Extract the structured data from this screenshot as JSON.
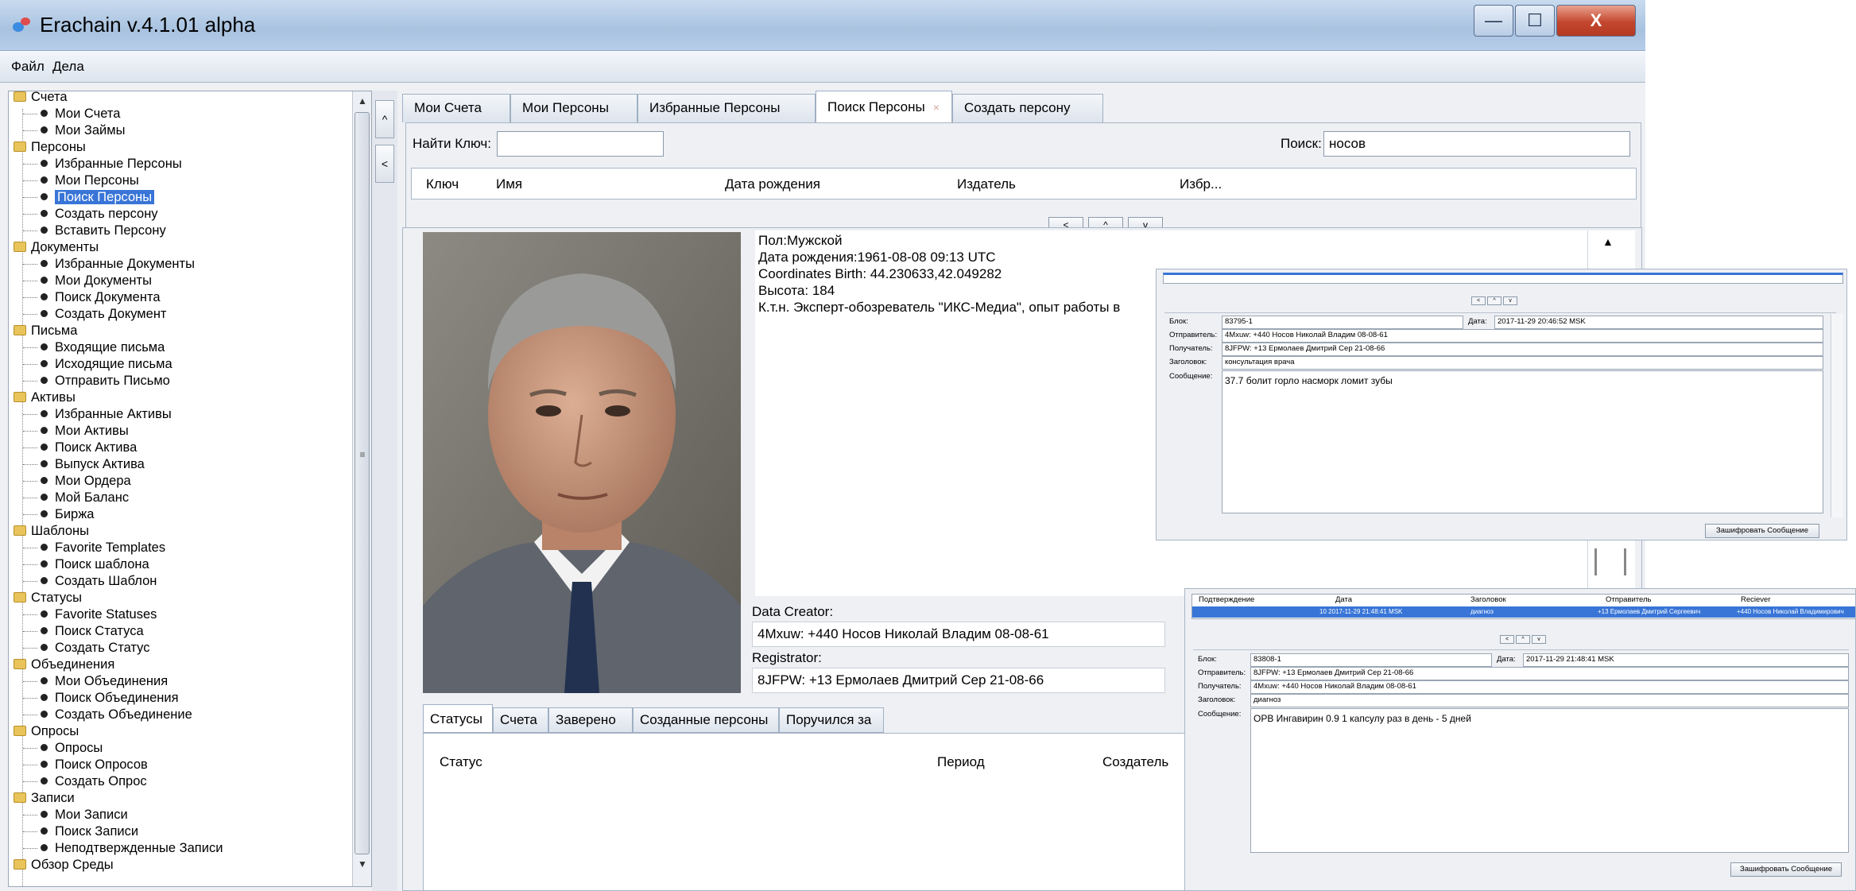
{
  "window": {
    "title": "Erachain v.4.1.01 alpha",
    "min": "—",
    "max": "☐",
    "close": "X"
  },
  "menu": [
    "Файл",
    "Дела"
  ],
  "tree": [
    {
      "label": "Счета",
      "type": "folder"
    },
    {
      "label": "Мои Счета",
      "type": "leaf"
    },
    {
      "label": "Мои Займы",
      "type": "leaf"
    },
    {
      "label": "Персоны",
      "type": "folder"
    },
    {
      "label": "Избранные Персоны",
      "type": "leaf"
    },
    {
      "label": "Мои Персоны",
      "type": "leaf"
    },
    {
      "label": "Поиск Персоны",
      "type": "leaf",
      "selected": true
    },
    {
      "label": "Создать персону",
      "type": "leaf"
    },
    {
      "label": "Вставить Персону",
      "type": "leaf"
    },
    {
      "label": "Документы",
      "type": "folder"
    },
    {
      "label": "Избранные Документы",
      "type": "leaf"
    },
    {
      "label": "Мои Документы",
      "type": "leaf"
    },
    {
      "label": "Поиск Документа",
      "type": "leaf"
    },
    {
      "label": "Создать Документ",
      "type": "leaf"
    },
    {
      "label": "Письма",
      "type": "folder"
    },
    {
      "label": "Входящие письма",
      "type": "leaf"
    },
    {
      "label": "Исходящие письма",
      "type": "leaf"
    },
    {
      "label": "Отправить Письмо",
      "type": "leaf"
    },
    {
      "label": "Активы",
      "type": "folder"
    },
    {
      "label": "Избранные Активы",
      "type": "leaf"
    },
    {
      "label": "Мои Активы",
      "type": "leaf"
    },
    {
      "label": "Поиск Актива",
      "type": "leaf"
    },
    {
      "label": "Выпуск Актива",
      "type": "leaf"
    },
    {
      "label": "Мои Ордера",
      "type": "leaf"
    },
    {
      "label": "Мой Баланс",
      "type": "leaf"
    },
    {
      "label": "Биржа",
      "type": "leaf"
    },
    {
      "label": "Шаблоны",
      "type": "folder"
    },
    {
      "label": "Favorite Templates",
      "type": "leaf"
    },
    {
      "label": "Поиск шаблона",
      "type": "leaf"
    },
    {
      "label": "Создать Шаблон",
      "type": "leaf"
    },
    {
      "label": "Статусы",
      "type": "folder"
    },
    {
      "label": "Favorite Statuses",
      "type": "leaf"
    },
    {
      "label": "Поиск Статуса",
      "type": "leaf"
    },
    {
      "label": "Создать Статус",
      "type": "leaf"
    },
    {
      "label": "Объединения",
      "type": "folder"
    },
    {
      "label": "Мои Объединения",
      "type": "leaf"
    },
    {
      "label": "Поиск Объединения",
      "type": "leaf"
    },
    {
      "label": "Создать Объединение",
      "type": "leaf"
    },
    {
      "label": "Опросы",
      "type": "folder"
    },
    {
      "label": "Опросы",
      "type": "leaf"
    },
    {
      "label": "Поиск Опросов",
      "type": "leaf"
    },
    {
      "label": "Создать Опрос",
      "type": "leaf"
    },
    {
      "label": "Записи",
      "type": "folder"
    },
    {
      "label": "Мои Записи",
      "type": "leaf"
    },
    {
      "label": "Поиск Записи",
      "type": "leaf"
    },
    {
      "label": "Неподтвержденные Записи",
      "type": "leaf"
    },
    {
      "label": "Обзор Среды",
      "type": "folder"
    }
  ],
  "tabs": [
    {
      "label": "Мои Счета",
      "active": false,
      "closable": false
    },
    {
      "label": "Мои Персоны",
      "active": false,
      "closable": false
    },
    {
      "label": "Избранные Персоны",
      "active": false,
      "closable": false
    },
    {
      "label": "Поиск Персоны",
      "active": true,
      "closable": true
    },
    {
      "label": "Создать персону",
      "active": false,
      "closable": false
    }
  ],
  "search": {
    "find_key_label": "Найти Ключ:",
    "find_key_value": "",
    "search_label": "Поиск:",
    "search_value": "носов",
    "columns": [
      "Ключ",
      "Имя",
      "Дата рождения",
      "Издатель",
      "Избр..."
    ],
    "nav": [
      "<",
      "^",
      "v"
    ]
  },
  "person": {
    "lines": [
      "Пол:Мужской",
      "Дата рождения:1961-08-08 09:13 UTC",
      "Coordinates Birth: 44.230633,42.049282",
      "Высота: 184",
      "К.т.н. Эксперт-обозреватель \"ИКС-Медиа\", опыт работы в"
    ],
    "data_creator_label": "Data Creator:",
    "data_creator_value": "4Mxuw: +440 Носов Николай Владим 08-08-61",
    "registrator_label": "Registrator:",
    "registrator_value": "8JFPW: +13 Ермолаев Дмитрий Сер 21-08-66"
  },
  "subtabs": [
    "Статусы",
    "Счета",
    "Заверено",
    "Созданные персоны",
    "Поручился за"
  ],
  "status_table": {
    "columns": [
      "Статус",
      "Период",
      "Создатель"
    ]
  },
  "popup1": {
    "nav": [
      "<",
      "^",
      "v"
    ],
    "block_label": "Блок:",
    "block": "83795-1",
    "date_label": "Дата:",
    "date": "2017-11-29 20:46:52 MSK",
    "sender_label": "Отправитель:",
    "sender": "4Mxuw: +440 Носов Николай Владим 08-08-61",
    "recipient_label": "Получатель:",
    "recipient": "8JFPW: +13 Ермолаев Дмитрий Сер 21-08-66",
    "subject_label": "Заголовок:",
    "subject": "консультация врача",
    "message_label": "Сообщение:",
    "message": "37.7 болит горло насморк ломит зубы",
    "encrypt_btn": "Зашифровать Сообщение"
  },
  "popup2": {
    "columns": [
      "Подтверждение",
      "Дата",
      "Заголовок",
      "Отправитель",
      "Reciever"
    ],
    "row": {
      "confirm": "",
      "date": "10 2017-11-29 21:48:41 MSK",
      "subject": "диагноз",
      "sender": "+13 Ермолаев Дмитрий Сергеевич",
      "receiver": "+440 Носов Николай Владимирович"
    },
    "nav": [
      "<",
      "^",
      "v"
    ],
    "block_label": "Блок:",
    "block": "83808-1",
    "date_label": "Дата:",
    "date": "2017-11-29 21:48:41 MSK",
    "sender_label": "Отправитель:",
    "sender": "8JFPW: +13 Ермолаев Дмитрий Сер 21-08-66",
    "recipient_label": "Получатель:",
    "recipient": "4Mxuw: +440 Носов Николай Владим 08-08-61",
    "subject_label": "Заголовок:",
    "subject": "диагноз",
    "message_label": "Сообщение:",
    "message": "ОРВ Ингавирин 0.9 1 капсулу раз в день - 5 дней",
    "encrypt_btn": "Зашифровать Сообщение"
  },
  "colors": {
    "selection": "#3875d7",
    "titlebar": "#b7cde8",
    "close": "#c3472e"
  }
}
